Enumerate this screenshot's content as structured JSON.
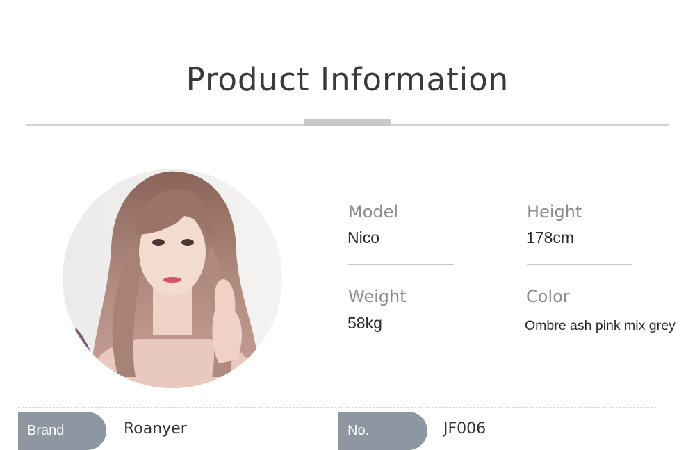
{
  "header": {
    "title": "Product Information"
  },
  "specs": {
    "model": {
      "label": "Model",
      "value": "Nico"
    },
    "height": {
      "label": "Height",
      "value": "178cm"
    },
    "weight": {
      "label": "Weight",
      "value": "58kg"
    },
    "color": {
      "label": "Color",
      "value": "Ombre ash pink mix grey"
    }
  },
  "footer": {
    "brand": {
      "label": "Brand",
      "value": "Roanyer"
    },
    "number": {
      "label": "No.",
      "value": "JF006"
    }
  },
  "colors": {
    "pill": "#8e97a1",
    "hair": "#a87f73",
    "divider": "#d2d2d2"
  }
}
